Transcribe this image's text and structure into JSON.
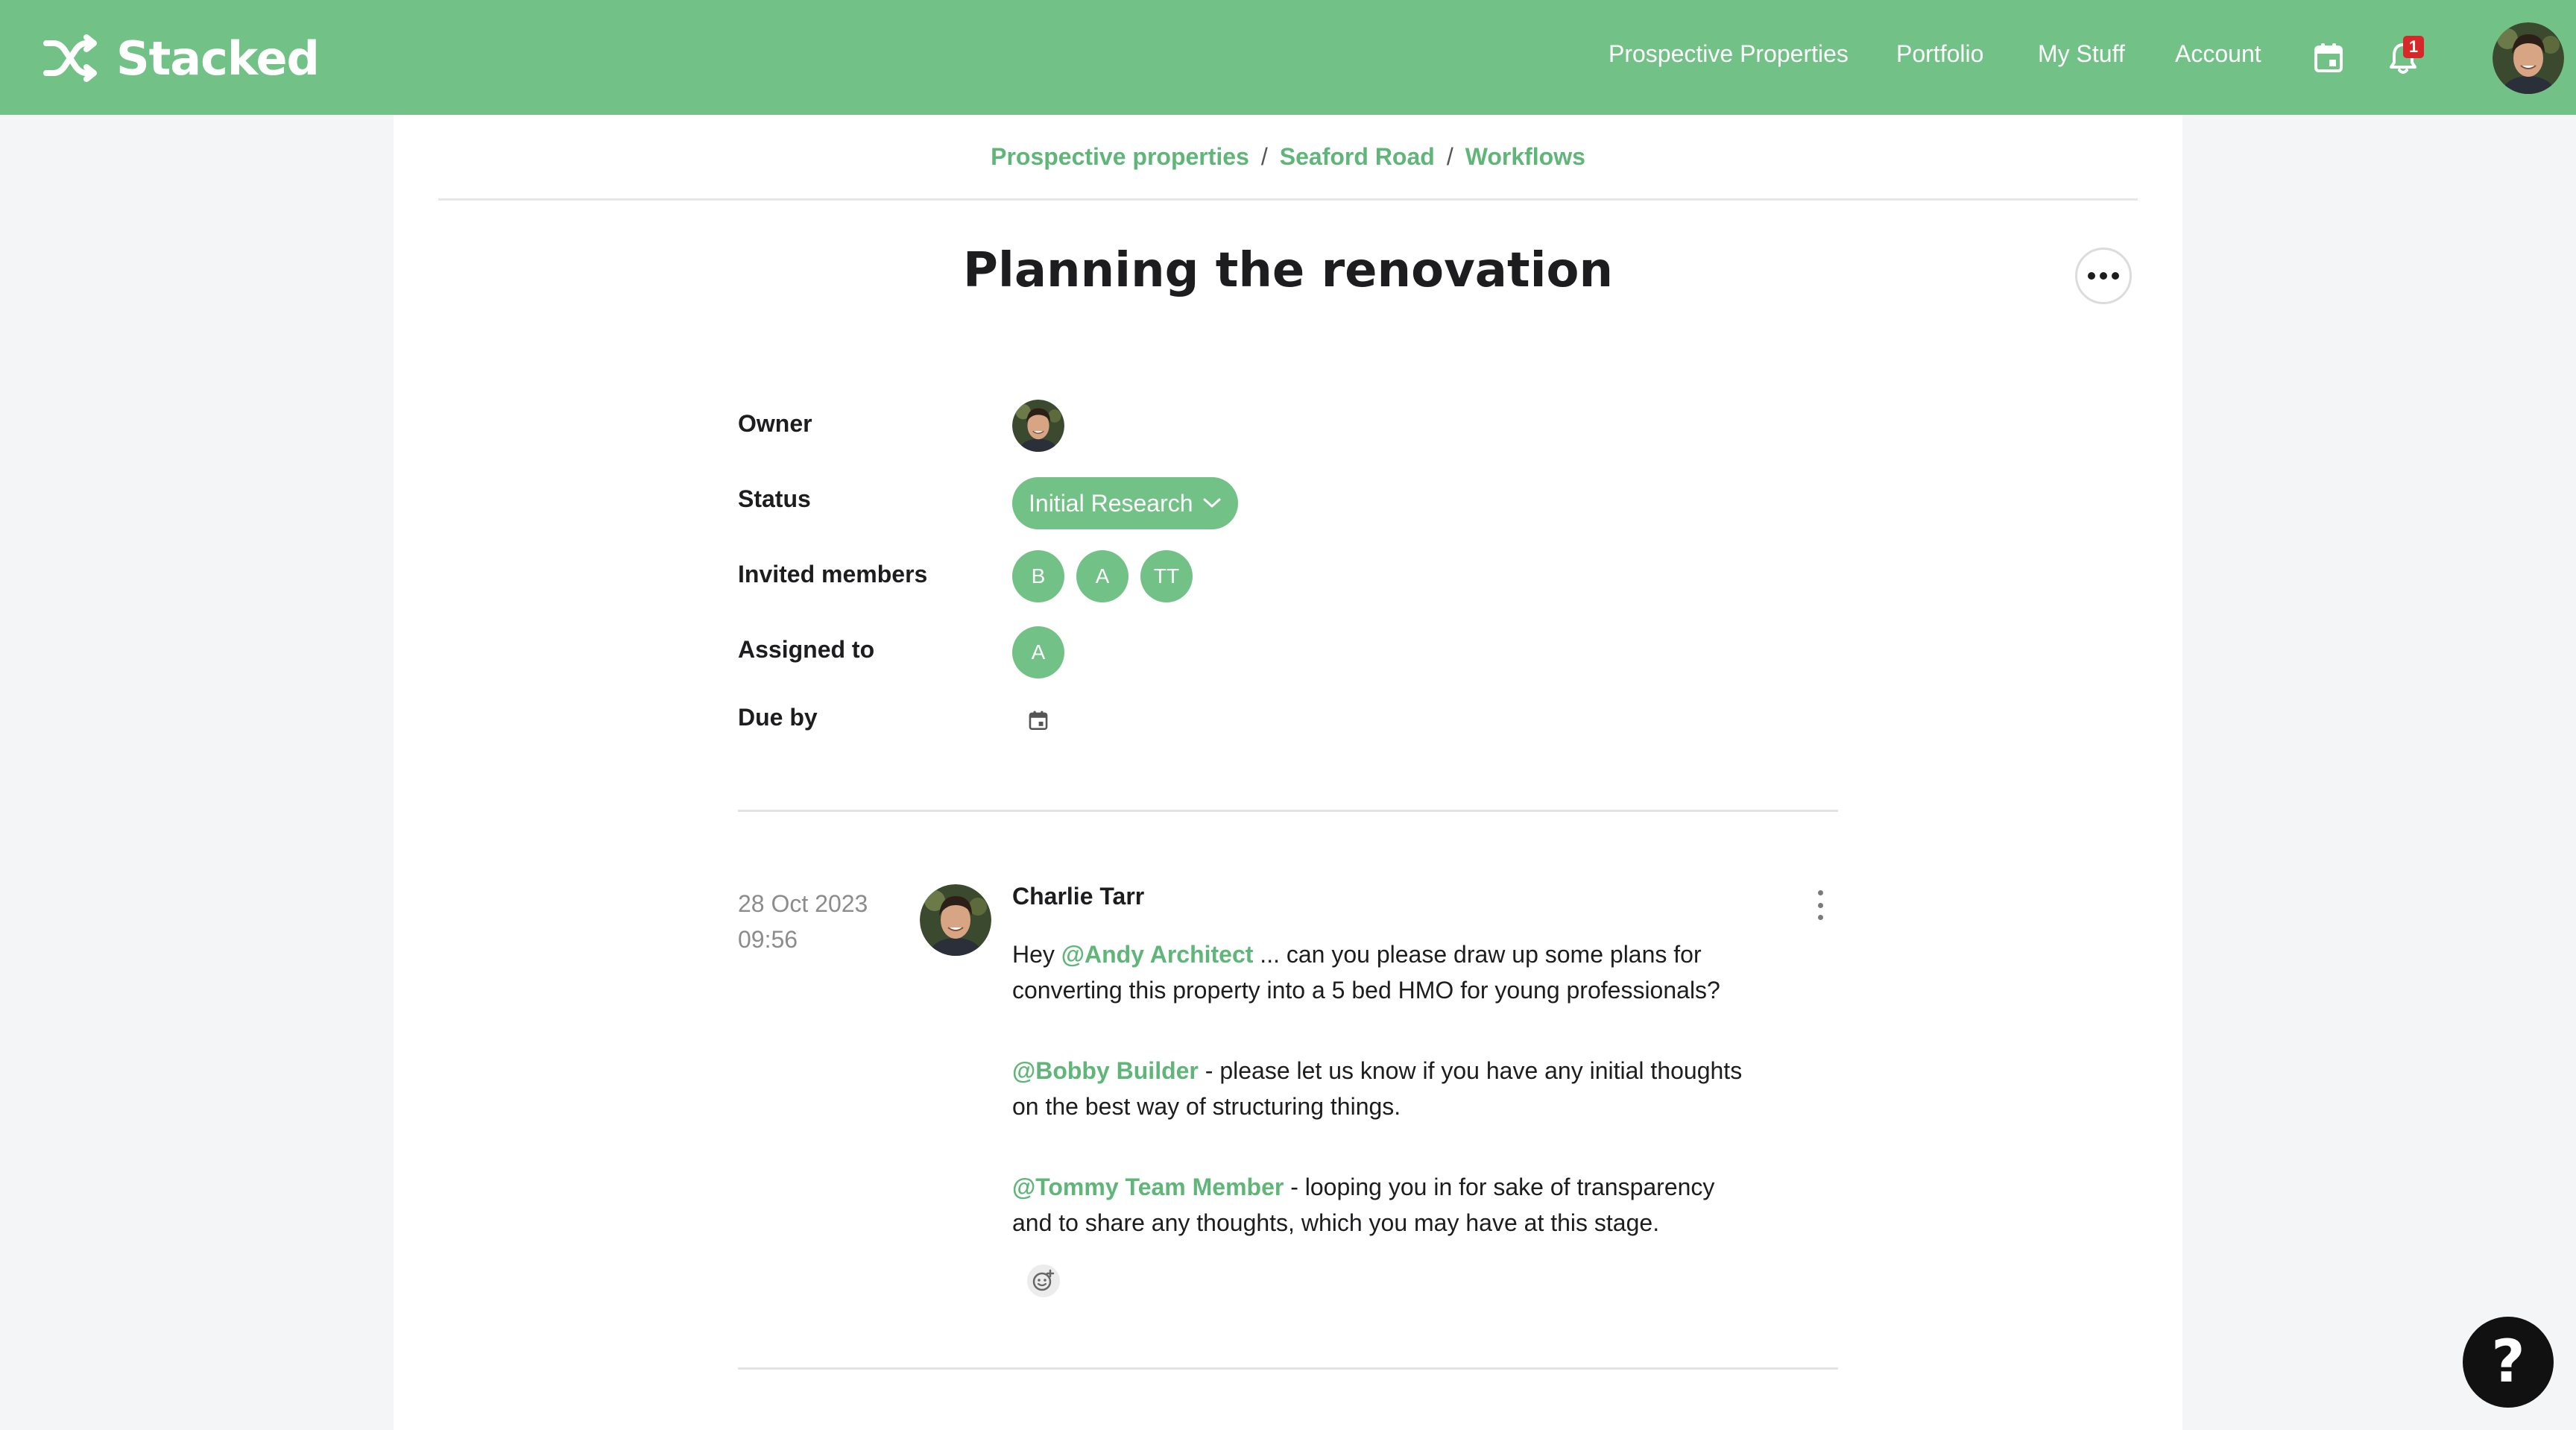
{
  "app": {
    "brand_name": "Stacked",
    "brand_color": "#72c186",
    "link_color": "#5fb678"
  },
  "nav": {
    "items": [
      {
        "label": "Prospective Properties"
      },
      {
        "label": "Portfolio"
      },
      {
        "label": "My Stuff"
      },
      {
        "label": "Account"
      }
    ],
    "calendar_icon": "calendar-icon",
    "notifications_icon": "bell-icon",
    "notification_count": "1"
  },
  "breadcrumb": {
    "items": [
      {
        "label": "Prospective properties"
      },
      {
        "label": "Seaford Road"
      },
      {
        "label": "Workflows"
      }
    ],
    "separator": "/"
  },
  "workflow": {
    "title": "Planning the renovation",
    "labels": {
      "owner": "Owner",
      "status": "Status",
      "invited_members": "Invited members",
      "assigned_to": "Assigned to",
      "due_by": "Due by"
    },
    "status": "Initial Research",
    "invited_members": [
      "B",
      "A",
      "TT"
    ],
    "assigned_to": [
      "A"
    ]
  },
  "comment": {
    "date": "28 Oct 2023",
    "time": "09:56",
    "author": "Charlie Tarr",
    "p1_prefix": "Hey ",
    "p1_mention": "@Andy Architect",
    "p1_text": " ... can you please draw up some plans for converting this property into a 5 bed HMO for young professionals?",
    "p2_mention": "@Bobby Builder",
    "p2_text": " - please let us know if you have any initial thoughts on the best way of structuring things.",
    "p3_mention": "@Tommy Team Member",
    "p3_text": " - looping you in for sake of transparency and to share any thoughts, which you may have at this stage."
  },
  "help": {
    "label": "?"
  }
}
